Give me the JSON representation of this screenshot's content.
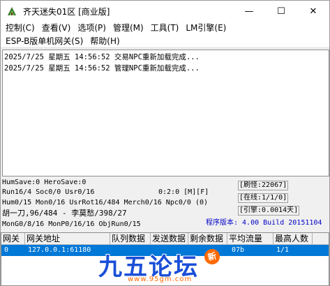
{
  "window": {
    "title": "齐天迷失01区 [商业版]",
    "controls": {
      "minimize": "—",
      "maximize": "☐",
      "close": "✕"
    }
  },
  "menu": {
    "row1": [
      "控制(C)",
      "查看(V)",
      "选项(P)",
      "管理(M)",
      "工具(T)",
      "LM引擎(E)"
    ],
    "row2": [
      "ESP-B版单机网关(S)",
      "帮助(H)"
    ]
  },
  "log": [
    "2025/7/25 星期五 14:56:52 交易NPC重新加载完成...",
    "2025/7/25 星期五 14:56:52 管理NPC重新加载完成..."
  ],
  "status": {
    "humsave": "HumSave:0 HeroSave:0",
    "run": "Run16/4 Soc0/0 Usr0/16",
    "time": "0:2:0 [M][F]",
    "hum": "Hum0/15 Mon0/16 UsrRot16/484 Merch0/16 Npc0/0 (0)",
    "player": "胡一刀,96/484 - 李莫愁/398/27",
    "mon": "MonG0/8/16 MonP0/16/16 ObjRun0/15",
    "refresh": "[刷怪:22067]",
    "online": "[在线:1/1/0]",
    "engine": "[引擎:0.0014天]",
    "version": "程序版本: 4.00 Build 20151104"
  },
  "table": {
    "headers": [
      "网关",
      "网关地址",
      "队列数据",
      "发送数据",
      "剩余数据",
      "平均流量",
      "最高人数"
    ],
    "rows": [
      [
        "0",
        "127.0.0.1:61180",
        "",
        "",
        "",
        "07b",
        "1/1"
      ]
    ]
  },
  "watermark": {
    "text": "九五论坛",
    "url": "www.95gm.com",
    "badge": "新"
  },
  "colors": {
    "selection": "#0078d7",
    "version_text": "#0000c8",
    "watermark_blue": "#1b4fd8",
    "watermark_orange": "#ff6a00"
  }
}
